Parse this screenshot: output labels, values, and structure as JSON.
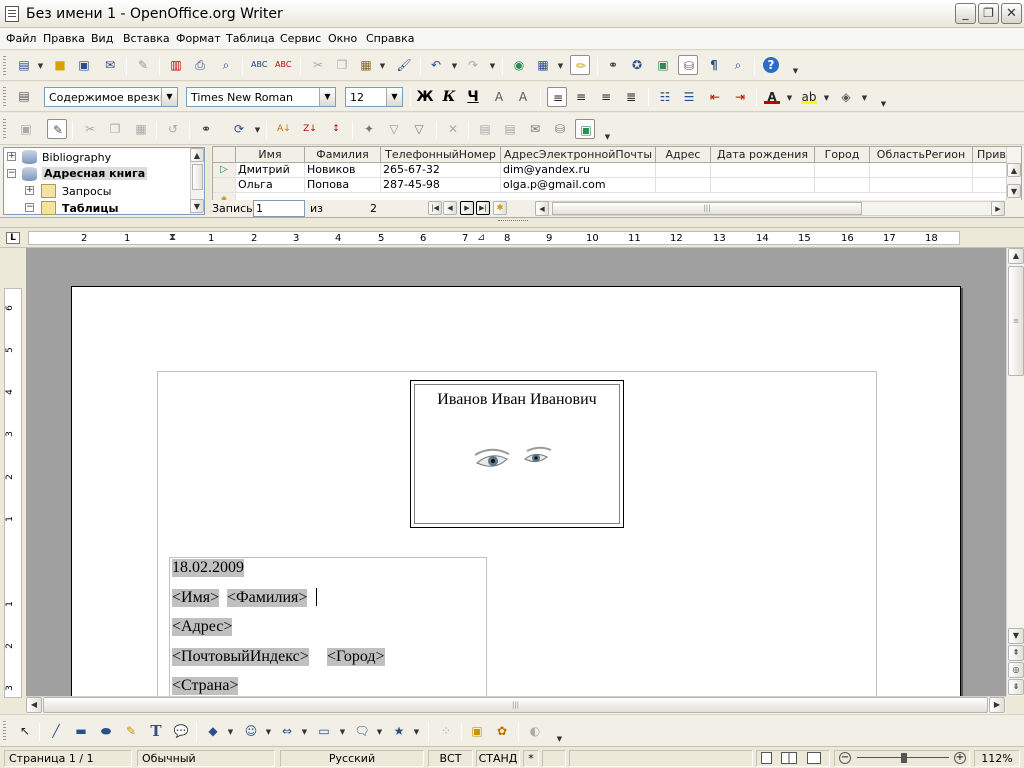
{
  "window": {
    "title": "Без имени 1 - OpenOffice.org Writer",
    "controls": {
      "minimize": "_",
      "maximize": "❐",
      "close": "✕"
    }
  },
  "menubar": [
    "Файл",
    "Правка",
    "Вид",
    "Вставка",
    "Формат",
    "Таблица",
    "Сервис",
    "Окно",
    "Справка"
  ],
  "formatting": {
    "paragraph_style": "Содержимое врезки",
    "font_name": "Times New Roman",
    "font_size": "12",
    "bold_label": "Ж",
    "italic_label": "К",
    "underline_label": "Ч"
  },
  "datasource": {
    "tree": [
      {
        "label": "Bibliography",
        "expander": "+"
      },
      {
        "label": "Адресная книга",
        "expander": "−",
        "bold": true,
        "selected": true
      },
      {
        "label": "Запросы",
        "expander": "+"
      },
      {
        "label": "Таблицы",
        "expander": "−",
        "bold": true
      }
    ],
    "columns": [
      "Имя",
      "Фамилия",
      "ТелефонныйНомер",
      "АдресЭлектроннойПочты",
      "Адрес",
      "Дата рождения",
      "Город",
      "ОбластьРегион",
      "Приветс"
    ],
    "rows": [
      [
        "Дмитрий",
        "Новиков",
        "265-67-32",
        "dim@yandex.ru",
        "",
        "",
        "",
        "",
        ""
      ],
      [
        "Ольга",
        "Попова",
        "287-45-98",
        "olga.p@gmail.com",
        "",
        "",
        "",
        "",
        ""
      ]
    ],
    "nav": {
      "record_label": "Запись",
      "record_value": "1",
      "of_label": "из",
      "total": "2"
    }
  },
  "ruler": {
    "left_nums": [
      "2",
      "1"
    ],
    "right_nums": [
      "1",
      "2",
      "3",
      "4",
      "5",
      "6",
      "7",
      "8",
      "9",
      "10",
      "11",
      "12",
      "13",
      "14",
      "15",
      "16",
      "17",
      "18"
    ],
    "vertical_nums": [
      "6",
      "5",
      "4",
      "3",
      "2",
      "1",
      "1",
      "2",
      "3"
    ]
  },
  "document": {
    "photo_caption": "Иванов Иван Иванович",
    "date": "18.02.2009",
    "fields": {
      "first_name": "<Имя>",
      "last_name": "<Фамилия>",
      "address": "<Адрес>",
      "zip": "<ПочтовыйИндекс>",
      "city": "<Город>",
      "country": "<Страна>"
    }
  },
  "statusbar": {
    "page": "Страница  1 / 1",
    "style": "Обычный",
    "language": "Русский",
    "insert_mode": "ВСТ",
    "selection_mode": "СТАНД",
    "modified": "*",
    "zoom": "112%"
  },
  "colors": {
    "accent": "#2B4E8C",
    "field_bg": "#C0C0C0",
    "canvas": "#A0A0A0"
  }
}
